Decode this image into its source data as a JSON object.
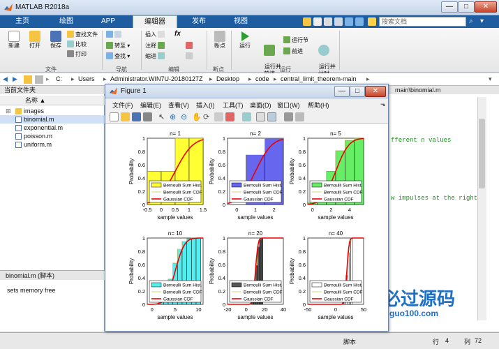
{
  "window": {
    "title": "MATLAB R2018a",
    "controls": {
      "minimize": "—",
      "maximize": "□",
      "close": "✕"
    }
  },
  "ribbon_tabs": [
    "主页",
    "绘图",
    "APP",
    "编辑器",
    "发布",
    "视图"
  ],
  "active_tab": "编辑器",
  "search_placeholder": "搜索文档",
  "ribbon": {
    "file": {
      "label": "文件",
      "new": "新建",
      "open": "打开",
      "save": "保存",
      "find_files": "查找文件",
      "compare": "比较",
      "print": "打印"
    },
    "nav": {
      "label": "导航",
      "goto": "转至",
      "find": "查找"
    },
    "edit": {
      "label": "编辑",
      "insert": "插入",
      "comment": "注释",
      "indent": "缩进",
      "fx": "fx"
    },
    "breakpoints": {
      "label": "断点",
      "btn": "断点"
    },
    "run": {
      "label": "运行",
      "run": "运行",
      "run_advance": "运行并\n前进",
      "run_section": "运行节",
      "advance": "前进",
      "run_time": "运行并\n计时"
    }
  },
  "address": {
    "crumbs": [
      "C:",
      "Users",
      "Administrator.WIN7U-20180127Z",
      "Desktop",
      "code",
      "central_limit_theorem-main"
    ]
  },
  "current_folder": {
    "header": "当前文件夹",
    "column": "名称 ▲",
    "files": [
      "images",
      "binomial.m",
      "exponential.m",
      "poisson.m",
      "uniform.m"
    ],
    "selected": "binomial.m"
  },
  "details": {
    "header": "binomial.m  (脚本)",
    "text": "sets memory free"
  },
  "editor": {
    "tab": "main\\binomial.m",
    "code_lines": [
      "fferent n values",
      "w impulses at the right p"
    ]
  },
  "figure": {
    "title": "Figure 1",
    "controls": {
      "minimize": "—",
      "maximize": "□",
      "close": "✕"
    },
    "menu": [
      "文件(F)",
      "编辑(E)",
      "查看(V)",
      "插入(I)",
      "工具(T)",
      "桌面(D)",
      "窗口(W)",
      "帮助(H)"
    ]
  },
  "status": {
    "script": "脚本",
    "row_label": "行",
    "row": "4",
    "col_label": "列",
    "col": "72"
  },
  "watermark": {
    "text": "必过源码",
    "url": "Biguo100.com"
  },
  "chart_data": [
    {
      "type": "bar",
      "title": "n= 1",
      "xlabel": "sample values",
      "ylabel": "Probability",
      "xlim": [
        -0.5,
        1.5
      ],
      "xticks": [
        -0.5,
        0,
        0.5,
        1,
        1.5
      ],
      "ylim": [
        0,
        1
      ],
      "yticks": [
        0,
        0.2,
        0.4,
        0.6,
        0.8,
        1
      ],
      "color": "#ffff33",
      "bins": [
        [
          -0.5,
          0,
          0.5
        ],
        [
          0,
          0.5,
          0.5
        ],
        [
          0.5,
          1,
          1.0
        ],
        [
          1,
          1.5,
          1.0
        ]
      ],
      "series": [
        {
          "name": "Bernoulli Sum Hist."
        },
        {
          "name": "Bernoulli Sum CDF"
        },
        {
          "name": "Gaussian CDF"
        }
      ],
      "gauss": [
        0.5,
        0.5
      ]
    },
    {
      "type": "bar",
      "title": "n= 2",
      "xlabel": "sample values",
      "ylabel": "Probability",
      "xlim": [
        -0.5,
        2.5
      ],
      "xticks": [
        0,
        1,
        2
      ],
      "ylim": [
        0,
        1
      ],
      "yticks": [
        0,
        0.2,
        0.4,
        0.6,
        0.8,
        1
      ],
      "color": "#6666ee",
      "bins": [
        [
          0.5,
          1.5,
          0.75
        ],
        [
          1.5,
          2.5,
          1.0
        ]
      ],
      "series": [
        {
          "name": "Bernoulli Sum Hist."
        },
        {
          "name": "Bernoulli Sum CDF"
        },
        {
          "name": "Gaussian CDF"
        }
      ],
      "gauss": [
        1,
        0.7
      ]
    },
    {
      "type": "bar",
      "title": "n= 5",
      "xlabel": "sample values",
      "ylabel": "Probability",
      "xlim": [
        -0.5,
        5.5
      ],
      "xticks": [
        0,
        2,
        4
      ],
      "ylim": [
        0,
        1
      ],
      "yticks": [
        0,
        0.2,
        0.4,
        0.6,
        0.8,
        1
      ],
      "color": "#66ee66",
      "bins": [
        [
          -0.5,
          0.5,
          0.03
        ],
        [
          0.5,
          1.5,
          0.19
        ],
        [
          1.5,
          2.5,
          0.5
        ],
        [
          2.5,
          3.5,
          0.81
        ],
        [
          3.5,
          4.5,
          0.97
        ],
        [
          4.5,
          5.5,
          1.0
        ]
      ],
      "series": [
        {
          "name": "Bernoulli Sum Hist."
        },
        {
          "name": "Bernoulli Sum CDF"
        },
        {
          "name": "Gaussian CDF"
        }
      ],
      "gauss": [
        2.5,
        1.12
      ]
    },
    {
      "type": "bar",
      "title": "n= 10",
      "xlabel": "sample values",
      "ylabel": "Probability",
      "xlim": [
        -1,
        11
      ],
      "xticks": [
        0,
        5,
        10
      ],
      "ylim": [
        0,
        1
      ],
      "yticks": [
        0,
        0.2,
        0.4,
        0.6,
        0.8,
        1
      ],
      "color": "#55eeee",
      "bins": [
        [
          1.5,
          2.5,
          0.05
        ],
        [
          2.5,
          3.5,
          0.17
        ],
        [
          3.5,
          4.5,
          0.38
        ],
        [
          4.5,
          5.5,
          0.62
        ],
        [
          5.5,
          6.5,
          0.83
        ],
        [
          6.5,
          7.5,
          0.95
        ],
        [
          7.5,
          8.5,
          0.99
        ],
        [
          8.5,
          9.5,
          1.0
        ],
        [
          9.5,
          10.5,
          1.0
        ]
      ],
      "series": [
        {
          "name": "Bernoulli Sum Hist."
        },
        {
          "name": "Bernoulli Sum CDF"
        },
        {
          "name": "Gaussian CDF"
        }
      ],
      "gauss": [
        5,
        1.58
      ]
    },
    {
      "type": "bar",
      "title": "n= 20",
      "xlabel": "sample values",
      "ylabel": "Probability",
      "xlim": [
        -20,
        40
      ],
      "xticks": [
        -20,
        0,
        20,
        40
      ],
      "ylim": [
        0,
        1
      ],
      "yticks": [
        0,
        0.2,
        0.4,
        0.6,
        0.8,
        1
      ],
      "color": "#555555",
      "bins": [
        [
          6,
          8,
          0.06
        ],
        [
          8,
          10,
          0.25
        ],
        [
          10,
          12,
          0.59
        ],
        [
          12,
          14,
          0.87
        ],
        [
          14,
          16,
          0.98
        ],
        [
          16,
          18,
          1.0
        ]
      ],
      "series": [
        {
          "name": "Bernoulli Sum Hist."
        },
        {
          "name": "Bernoulli Sum CDF"
        },
        {
          "name": "Gaussian CDF"
        }
      ],
      "gauss": [
        10,
        2.24
      ]
    },
    {
      "type": "bar",
      "title": "n= 40",
      "xlabel": "sample values",
      "ylabel": "Probability",
      "xlim": [
        -50,
        50
      ],
      "xticks": [
        -50,
        0,
        50
      ],
      "ylim": [
        0,
        1
      ],
      "yticks": [
        0,
        0.2,
        0.4,
        0.6,
        0.8,
        1
      ],
      "color": "#ffffff",
      "bins": [
        [
          12,
          15,
          0.04
        ],
        [
          15,
          18,
          0.13
        ],
        [
          18,
          21,
          0.44
        ],
        [
          21,
          24,
          0.78
        ],
        [
          24,
          27,
          0.95
        ],
        [
          27,
          30,
          1.0
        ]
      ],
      "series": [
        {
          "name": "Bernoulli Sum Hist."
        },
        {
          "name": "Bernoulli Sum CDF"
        },
        {
          "name": "Gaussian CDF"
        }
      ],
      "gauss": [
        20,
        3.16
      ]
    }
  ]
}
